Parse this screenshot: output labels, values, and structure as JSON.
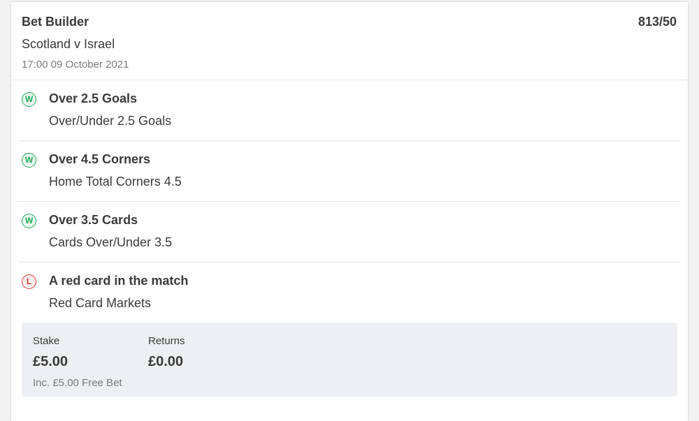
{
  "bet": {
    "type": "Bet Builder",
    "odds": "813/50",
    "event": "Scotland v Israel",
    "datetime": "17:00 09 October 2021"
  },
  "selections": [
    {
      "result": "W",
      "name": "Over 2.5 Goals",
      "market": "Over/Under 2.5 Goals"
    },
    {
      "result": "W",
      "name": "Over 4.5 Corners",
      "market": "Home Total Corners 4.5"
    },
    {
      "result": "W",
      "name": "Over 3.5 Cards",
      "market": "Cards Over/Under 3.5"
    },
    {
      "result": "L",
      "name": "A red card in the match",
      "market": "Red Card Markets"
    }
  ],
  "summary": {
    "stake_label": "Stake",
    "stake_value": "£5.00",
    "free_bet_note": "Inc. £5.00 Free Bet",
    "returns_label": "Returns",
    "returns_value": "£0.00"
  },
  "colors": {
    "win": "#1fa85a",
    "loss": "#d63b3b",
    "summary_background": "#eeeff3"
  }
}
